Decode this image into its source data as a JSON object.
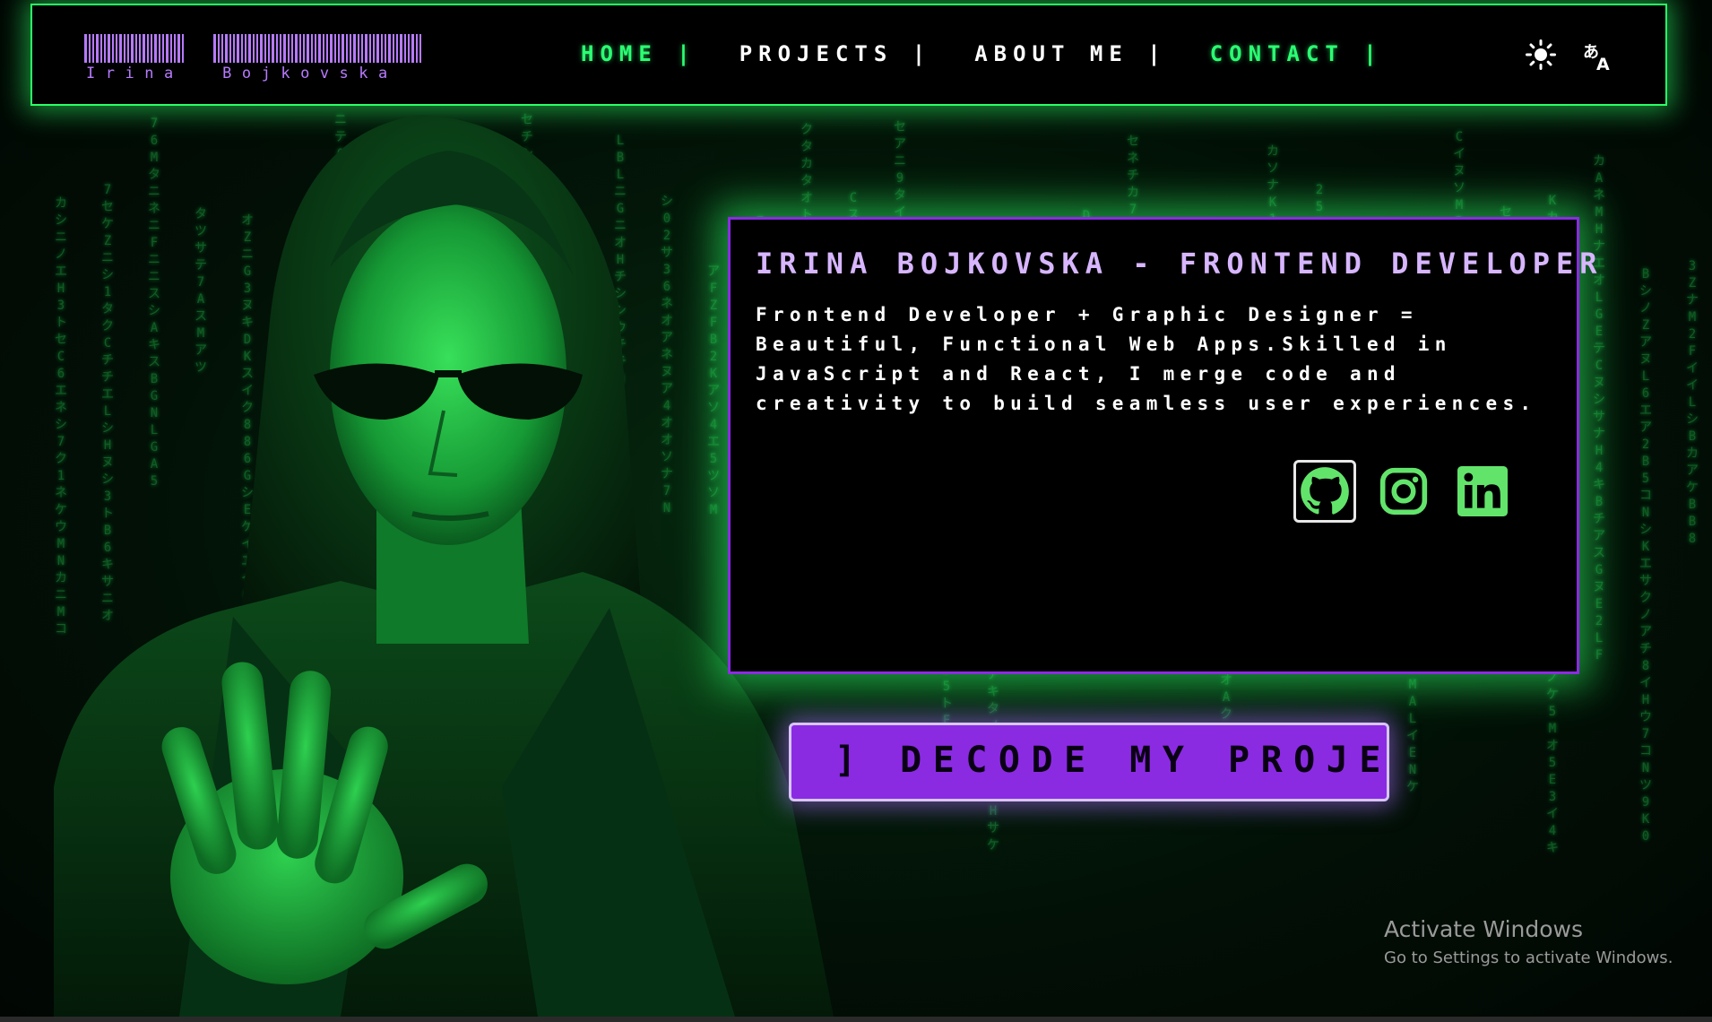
{
  "logo": {
    "text": "Irina  Bojkovska"
  },
  "nav": {
    "items": [
      {
        "label": "HOME |",
        "active": true
      },
      {
        "label": "PROJECTS |",
        "active": false
      },
      {
        "label": "ABOUT ME |",
        "active": false
      },
      {
        "label": "CONTACT |",
        "active": true
      }
    ],
    "icons": {
      "theme": "sun-icon",
      "language": "translate-icon"
    }
  },
  "intro": {
    "title": "IRINA BOJKOVSKA - FRONTEND DEVELOPER",
    "body": "Frontend Developer + Graphic Designer = Beautiful, Functional Web Apps.Skilled in JavaScript and React, I merge code and creativity to build seamless user experiences.",
    "socials": [
      "github-icon",
      "instagram-icon",
      "linkedin-icon"
    ]
  },
  "cta": {
    "label": "] DECODE MY PROJECTS"
  },
  "watermark": {
    "title": "Activate Windows",
    "subtitle": "Go to Settings to activate Windows."
  },
  "colors": {
    "accent_green": "#2bff66",
    "accent_purple": "#8a2be2",
    "title_purple": "#d7b6ff"
  }
}
